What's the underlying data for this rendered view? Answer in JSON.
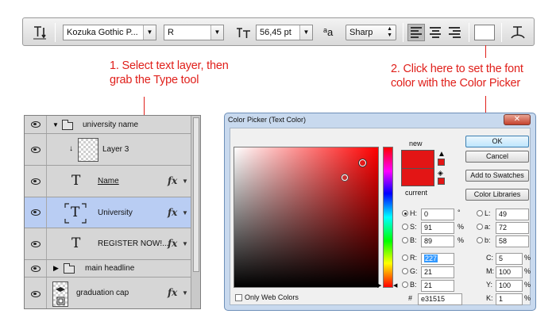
{
  "optionsbar": {
    "font_family": "Kozuka Gothic P...",
    "font_style": "R",
    "font_size": "56,45 pt",
    "aa_label": "a",
    "aa_label2": "a",
    "antialias": "Sharp"
  },
  "annotations": {
    "note1_line1": "1. Select text layer, then",
    "note1_line2": "grab the Type tool",
    "note2_line1": "2. Click here to set the font",
    "note2_line2": "color with the Color Picker"
  },
  "layers": [
    {
      "name": "university name",
      "kind": "group-open"
    },
    {
      "name": "Layer 3",
      "kind": "raster"
    },
    {
      "name": "Name",
      "kind": "text",
      "fx": "fx"
    },
    {
      "name": "University",
      "kind": "text-selected",
      "fx": "fx"
    },
    {
      "name": "REGISTER NOW!...",
      "kind": "text",
      "fx": "fx"
    },
    {
      "name": "main headline",
      "kind": "group-closed"
    },
    {
      "name": "graduation cap",
      "kind": "smart",
      "fx": "fx"
    }
  ],
  "picker": {
    "title": "Color Picker (Text Color)",
    "close": "✕",
    "new_label": "new",
    "current_label": "current",
    "new_color": "#e31515",
    "current_color": "#e31515",
    "ok": "OK",
    "cancel": "Cancel",
    "add_swatches": "Add to Swatches",
    "libraries": "Color Libraries",
    "h_label": "H:",
    "h_value": "0",
    "h_unit": "°",
    "s_label": "S:",
    "s_value": "91",
    "s_unit": "%",
    "b_label": "B:",
    "b_value": "89",
    "b_unit": "%",
    "r_label": "R:",
    "r_value": "227",
    "g_label": "G:",
    "g_value": "21",
    "bb_label": "B:",
    "bb_value": "21",
    "l_label": "L:",
    "l_value": "49",
    "a_label": "a:",
    "a_value": "72",
    "b2_label": "b:",
    "b2_value": "58",
    "c_label": "C:",
    "c_value": "5",
    "c_unit": "%",
    "m_label": "M:",
    "m_value": "100",
    "m_unit": "%",
    "y_label": "Y:",
    "y_value": "100",
    "y_unit": "%",
    "k_label": "K:",
    "k_value": "1",
    "k_unit": "%",
    "hex_label": "#",
    "hex_value": "e31515",
    "web_only": "Only Web Colors"
  }
}
